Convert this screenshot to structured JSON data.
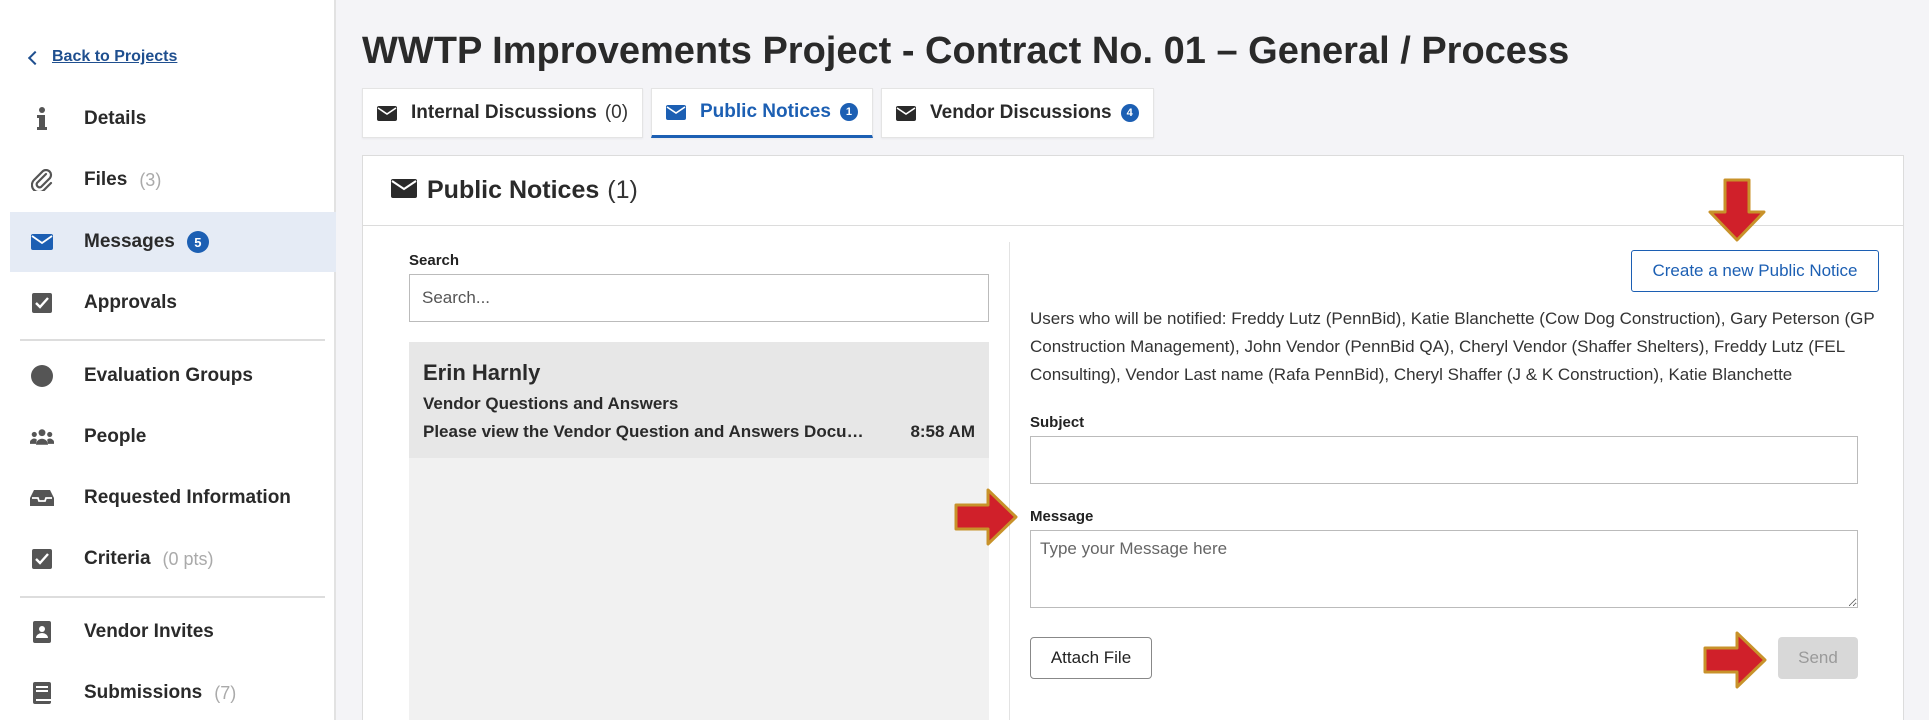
{
  "sidebar": {
    "back_label": "Back to Projects",
    "items": [
      {
        "label": "Details",
        "icon": "info-icon"
      },
      {
        "label": "Files",
        "count": "(3)",
        "icon": "paperclip-icon"
      },
      {
        "label": "Messages",
        "badge": "5",
        "icon": "envelope-icon"
      },
      {
        "label": "Approvals",
        "icon": "checkbox-icon"
      },
      {
        "label": "Evaluation Groups",
        "icon": "circle-icon"
      },
      {
        "label": "People",
        "icon": "users-icon"
      },
      {
        "label": "Requested Information",
        "icon": "inbox-icon"
      },
      {
        "label": "Criteria",
        "count": "(0 pts)",
        "icon": "checkbox-icon"
      },
      {
        "label": "Vendor Invites",
        "icon": "contact-book-icon"
      },
      {
        "label": "Submissions",
        "count": "(7)",
        "icon": "book-icon"
      }
    ]
  },
  "header": {
    "title": "WWTP Improvements Project - Contract No. 01 – General / Process"
  },
  "tabs": [
    {
      "label": "Internal Discussions",
      "count": "(0)"
    },
    {
      "label": "Public Notices",
      "badge": "1"
    },
    {
      "label": "Vendor Discussions",
      "badge": "4"
    }
  ],
  "panel": {
    "title": "Public Notices",
    "count": "(1)",
    "search_label": "Search",
    "search_placeholder": "Search...",
    "messages": [
      {
        "sender": "Erin Harnly",
        "subject": "Vendor Questions and Answers",
        "preview": "Please view the Vendor Question and Answers Document",
        "time": "8:58 AM"
      }
    ],
    "create_label": "Create a new Public Notice",
    "notified_text": "Users who will be notified: Freddy Lutz (PennBid), Katie Blanchette (Cow Dog Construction), Gary Peterson (GP Construction Management), John Vendor (PennBid QA), Cheryl Vendor (Shaffer Shelters), Freddy Lutz (FEL Consulting), Vendor Last name (Rafa PennBid), Cheryl Shaffer (J & K Construction), Katie Blanchette",
    "subject_label": "Subject",
    "message_label": "Message",
    "message_placeholder": "Type your Message here",
    "attach_label": "Attach File",
    "send_label": "Send"
  },
  "colors": {
    "accent": "#1c5fb3",
    "arrow_fill": "#d0202a",
    "arrow_stroke": "#c8922a"
  }
}
